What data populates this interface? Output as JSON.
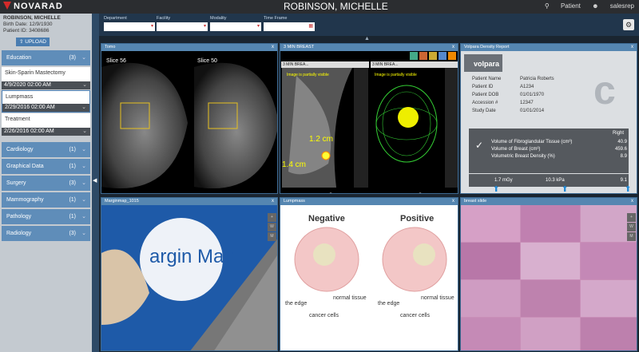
{
  "app": {
    "logo": "NOVARAD",
    "patient_title": "ROBINSON, MICHELLE",
    "patient_link": "Patient",
    "user": "salesrep"
  },
  "patient": {
    "name": "ROBINSON, MICHELLE",
    "birth": "Birth Date: 12/9/1930",
    "id": "Patient ID: 3408686"
  },
  "upload_label": "UPLOAD",
  "categories_top": {
    "label": "Education",
    "count": "(3)"
  },
  "studies": [
    {
      "name": "Skin-Sparin Mastectomy",
      "date": "4/9/2020 02:00 AM"
    },
    {
      "name": "Lumpmass",
      "date": "2/29/2016 02:00 AM"
    },
    {
      "name": "Treatment",
      "date": "2/26/2016 02:00 AM"
    }
  ],
  "categories": [
    {
      "label": "Cardiology",
      "count": "(1)"
    },
    {
      "label": "Graphical Data",
      "count": "(1)"
    },
    {
      "label": "Surgery",
      "count": "(3)"
    },
    {
      "label": "Mammography",
      "count": "(1)"
    },
    {
      "label": "Pathology",
      "count": "(1)"
    },
    {
      "label": "Radiology",
      "count": "(3)"
    }
  ],
  "filters": [
    {
      "label": "Department"
    },
    {
      "label": "Facility"
    },
    {
      "label": "Modality"
    },
    {
      "label": "Time Frame"
    }
  ],
  "panels": {
    "tomo": {
      "title": "Tomo",
      "slice_left": "Slice 56",
      "slice_right": "Slice 50"
    },
    "breast3d": {
      "title": "3 MIN BREAST",
      "sub_left": "3 MIN BREA...",
      "sub_right": "3 MIN BREA...",
      "warn": "Image is partially visible",
      "meas1": "1.2 cm",
      "meas2": "1.4 cm"
    },
    "volpara": {
      "title": "Volpara Density Report",
      "logo": "volpara",
      "fields": [
        {
          "k": "Patient Name",
          "v": "Patricia Roberts"
        },
        {
          "k": "Patient ID",
          "v": "A1234"
        },
        {
          "k": "Patient DOB",
          "v": "01/01/1970"
        },
        {
          "k": "Accession #",
          "v": "12347"
        },
        {
          "k": "Study Date",
          "v": "01/01/2014"
        }
      ],
      "side": "Right",
      "metrics": [
        {
          "k": "Volume of Fibroglandular Tissue (cm³)",
          "v": "40.9"
        },
        {
          "k": "Volume of Breast (cm³)",
          "v": "459.6"
        },
        {
          "k": "Volumetric Breast Density (%)",
          "v": "8.9"
        }
      ],
      "dose": "1.7 mGy",
      "pressure": "10.3 kPa",
      "extra": "9.1"
    },
    "margin": {
      "title": "Marginmap_1015",
      "logo_text": "argin Map"
    },
    "lumpmass": {
      "title": "Lumpmass",
      "neg": "Negative",
      "pos": "Positive",
      "edge": "the edge",
      "normal": "normal tissue",
      "cancer": "cancer cells"
    },
    "slide": {
      "title": "breast slide"
    }
  },
  "close": "x"
}
